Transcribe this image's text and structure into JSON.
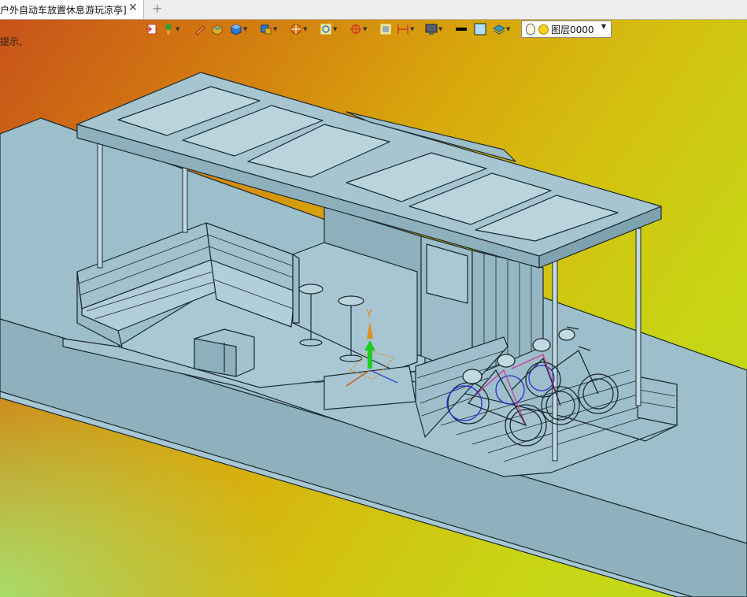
{
  "tabs": {
    "active_title": "户外自动车放置休息游玩凉亭]",
    "close_label": "✕",
    "add_label": "+"
  },
  "hint_text": "提示,",
  "toolbar": {
    "items": [
      {
        "name": "import-icon",
        "color": "#d03a2a"
      },
      {
        "name": "lamp-icon",
        "color": "#3e9a2e"
      },
      {
        "name": "pencil-icon",
        "color": "#d8a030"
      },
      {
        "name": "box-yellow-icon",
        "color": "#e0b020"
      },
      {
        "name": "cube-blue-icon",
        "color": "#2a7ad0"
      },
      {
        "name": "cube-stack-icon",
        "color": "#2a7ad0"
      },
      {
        "name": "sphere-orange-icon",
        "color": "#e07a10"
      },
      {
        "name": "zoom-frame-icon",
        "color": "#c8a020"
      },
      {
        "name": "rotate-axis-icon",
        "color": "#d03a2a"
      },
      {
        "name": "view-fit-icon",
        "color": "#c8a020"
      },
      {
        "name": "dimension-icon",
        "color": "#d03a2a"
      },
      {
        "name": "monitor-icon",
        "color": "#556070"
      },
      {
        "name": "line-black-icon",
        "color": "#000000"
      },
      {
        "name": "color-swatch-icon",
        "color": "#aee0f8"
      },
      {
        "name": "layers-icon",
        "color": "#3a9ab0"
      }
    ],
    "layer_name": "图层0000"
  },
  "colors": {
    "model_fill": "#9dbfcc",
    "model_stroke": "#1a2a30",
    "axis_y": "#22cc22",
    "axis_label": "#e09020"
  },
  "axis": {
    "label": "Y"
  }
}
